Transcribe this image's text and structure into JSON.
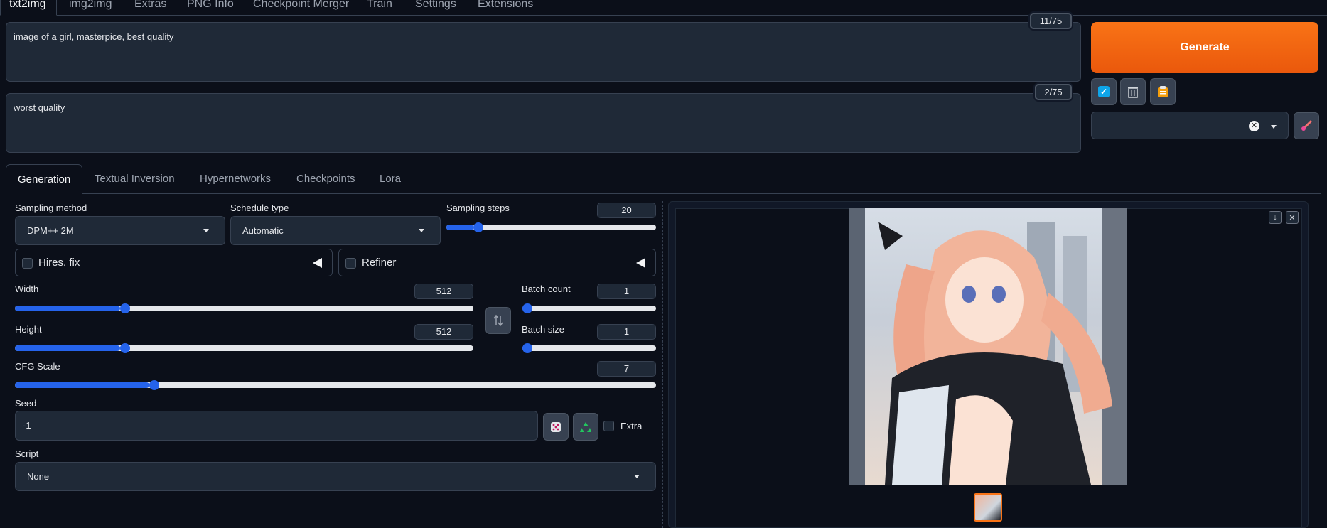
{
  "top_tabs": [
    "txt2img",
    "img2img",
    "Extras",
    "PNG Info",
    "Checkpoint Merger",
    "Train",
    "Settings",
    "Extensions"
  ],
  "prompt": {
    "text": "image of a girl, masterpice, best quality",
    "tokens": "11/75"
  },
  "negative_prompt": {
    "text": "worst quality",
    "tokens": "2/75"
  },
  "generate_label": "Generate",
  "gen_tabs": [
    "Generation",
    "Textual Inversion",
    "Hypernetworks",
    "Checkpoints",
    "Lora"
  ],
  "sampling_method": {
    "label": "Sampling method",
    "value": "DPM++ 2M"
  },
  "schedule_type": {
    "label": "Schedule type",
    "value": "Automatic"
  },
  "sampling_steps": {
    "label": "Sampling steps",
    "value": "20",
    "fraction": 0.13
  },
  "hires_fix": {
    "label": "Hires. fix",
    "checked": false
  },
  "refiner": {
    "label": "Refiner",
    "checked": false
  },
  "width": {
    "label": "Width",
    "value": "512",
    "fraction": 0.23
  },
  "height": {
    "label": "Height",
    "value": "512",
    "fraction": 0.23
  },
  "batch_count": {
    "label": "Batch count",
    "value": "1",
    "fraction": 0
  },
  "batch_size": {
    "label": "Batch size",
    "value": "1",
    "fraction": 0
  },
  "cfg_scale": {
    "label": "CFG Scale",
    "value": "7",
    "fraction": 0.21
  },
  "seed": {
    "label": "Seed",
    "value": "-1",
    "extra_label": "Extra"
  },
  "script": {
    "label": "Script",
    "value": "None"
  },
  "colors": {
    "accent": "#2563eb",
    "generate": "#f97316",
    "background": "#0b0f19"
  }
}
